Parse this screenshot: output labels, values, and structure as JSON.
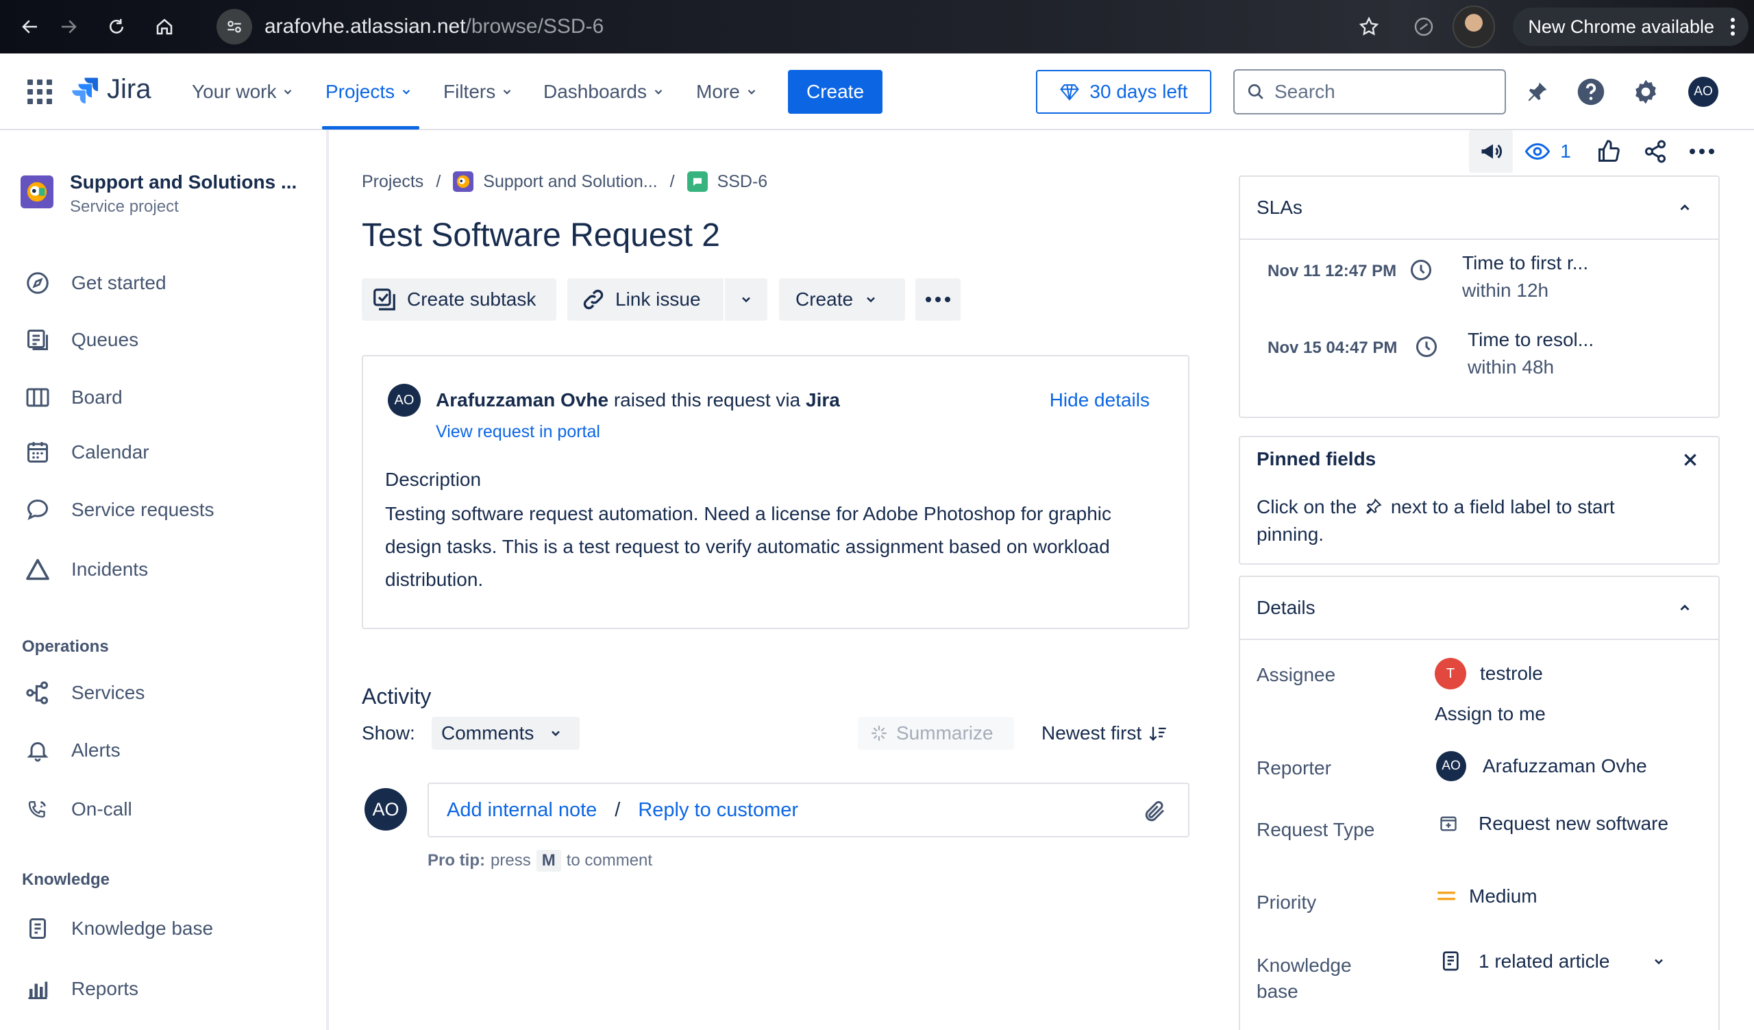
{
  "browser": {
    "url_host": "arafovhe.atlassian.net",
    "url_path": "/browse/SSD-6",
    "update_label": "New Chrome available"
  },
  "topnav": {
    "product": "Jira",
    "items": [
      {
        "label": "Your work"
      },
      {
        "label": "Projects"
      },
      {
        "label": "Filters"
      },
      {
        "label": "Dashboards"
      },
      {
        "label": "More"
      }
    ],
    "create_label": "Create",
    "trial_label": "30 days left",
    "search_placeholder": "Search",
    "user_initials": "AO"
  },
  "sidebar": {
    "project_name": "Support and Solutions ...",
    "project_type": "Service project",
    "items": [
      {
        "label": "Get started",
        "icon": "compass-icon"
      },
      {
        "label": "Queues",
        "icon": "queues-icon"
      },
      {
        "label": "Board",
        "icon": "board-icon"
      },
      {
        "label": "Calendar",
        "icon": "calendar-icon"
      },
      {
        "label": "Service requests",
        "icon": "chat-icon"
      },
      {
        "label": "Incidents",
        "icon": "warning-icon"
      }
    ],
    "operations_heading": "Operations",
    "operations": [
      {
        "label": "Services",
        "icon": "services-icon"
      },
      {
        "label": "Alerts",
        "icon": "bell-icon"
      },
      {
        "label": "On-call",
        "icon": "on-call-icon"
      }
    ],
    "knowledge_heading": "Knowledge",
    "knowledge": [
      {
        "label": "Knowledge base",
        "icon": "book-icon"
      },
      {
        "label": "Reports",
        "icon": "chart-icon"
      }
    ]
  },
  "breadcrumb": {
    "root": "Projects",
    "project": "Support and Solution...",
    "issue": "SSD-6"
  },
  "issue": {
    "title": "Test Software Request 2",
    "actions": {
      "create_subtask": "Create subtask",
      "link_issue": "Link issue",
      "create": "Create"
    },
    "request": {
      "reporter_initials": "AO",
      "reporter": "Arafuzzaman Ovhe",
      "raised_text": "raised this request via",
      "channel": "Jira",
      "portal_link": "View request in portal",
      "hide_details": "Hide details",
      "description_heading": "Description",
      "description": "Testing software request automation. Need a license for Adobe Photoshop for graphic design tasks. This is a test request to verify automatic assignment based on workload distribution."
    }
  },
  "activity": {
    "heading": "Activity",
    "show_label": "Show:",
    "filter_value": "Comments",
    "summarize_label": "Summarize",
    "sort_label": "Newest first",
    "user_initials": "AO",
    "add_internal_note": "Add internal note",
    "separator": "/",
    "reply_to_customer": "Reply to customer",
    "protip_label": "Pro tip:",
    "protip_press": "press",
    "protip_key": "M",
    "protip_suffix": "to comment"
  },
  "right_toolbar": {
    "watchers_count": "1"
  },
  "slas": {
    "heading": "SLAs",
    "items": [
      {
        "date": "Nov 11 12:47 PM",
        "name": "Time to first r...",
        "goal": "within 12h"
      },
      {
        "date": "Nov 15 04:47 PM",
        "name": "Time to resol...",
        "goal": "within 48h"
      }
    ]
  },
  "pinned": {
    "heading": "Pinned fields",
    "text_before": "Click on the",
    "text_after": "next to a field label to start pinning."
  },
  "details": {
    "heading": "Details",
    "assignee_label": "Assignee",
    "assignee_initial": "T",
    "assignee": "testrole",
    "assign_to_me": "Assign to me",
    "reporter_label": "Reporter",
    "reporter_initials": "AO",
    "reporter": "Arafuzzaman Ovhe",
    "request_type_label": "Request Type",
    "request_type": "Request new software",
    "priority_label": "Priority",
    "priority": "Medium",
    "knowledge_label": "Knowledge base",
    "knowledge_value": "1 related article"
  },
  "colors": {
    "brand_blue": "#0c66e4",
    "text": "#172b4d",
    "subtle": "#44546f",
    "assignee_avatar": "#e2483d",
    "priority_medium": "#f5a524"
  }
}
